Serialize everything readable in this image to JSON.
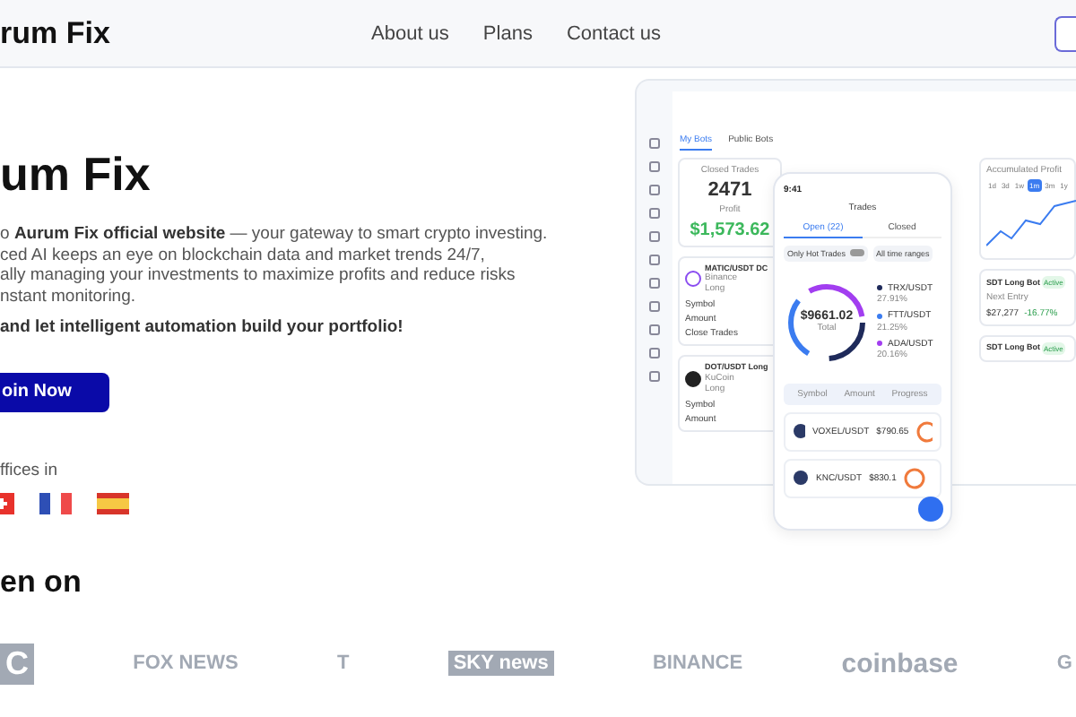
{
  "header": {
    "logo": "rum Fix",
    "nav": [
      "About us",
      "Plans",
      "Contact us"
    ]
  },
  "hero": {
    "title": "um Fix",
    "lines": [
      "o **Aurum Fix official website** — your gateway to smart crypto investing.",
      "ced AI keeps an eye on blockchain data and market trends 24/7,",
      "ally managing your investments to maximize profits and reduce risks",
      "nstant monitoring."
    ],
    "tagline": "and let intelligent automation build your portfolio!",
    "cta": "oin Now",
    "offices_label": "ffices in"
  },
  "dashboard": {
    "tabs": [
      {
        "label": "My Bots",
        "selected": true
      },
      {
        "label": "Public Bots",
        "selected": false
      }
    ],
    "closed_label": "Closed Trades",
    "closed_value": "2471",
    "profit_label": "Profit",
    "profit_value": "$1,573.62",
    "chart_title": "Accumulated Profit",
    "ranges": [
      {
        "label": "1d",
        "selected": false
      },
      {
        "label": "3d",
        "selected": false
      },
      {
        "label": "1w",
        "selected": false
      },
      {
        "label": "1m",
        "selected": true
      },
      {
        "label": "3m",
        "selected": false
      },
      {
        "label": "1y",
        "selected": false
      }
    ],
    "bots": [
      {
        "pair": "MATIC/USDT DC",
        "exchange": "Binance",
        "side": "Long",
        "fields": [
          "Symbol",
          "Amount",
          "Close Trades"
        ]
      },
      {
        "pair": "DOT/USDT Long",
        "exchange": "KuCoin",
        "side": "Long",
        "fields": [
          "Symbol",
          "Amount"
        ]
      }
    ],
    "right_bots": [
      {
        "title": "SDT Long Bot",
        "status": "Active",
        "stat_label": "Next Entry",
        "stat_value": "$27,277",
        "change": "-16.77%"
      },
      {
        "title": "SDT Long Bot",
        "status": "Active"
      }
    ]
  },
  "phone": {
    "time": "9:41",
    "title": "Trades",
    "tabs": [
      {
        "label": "Open (22)",
        "selected": true
      },
      {
        "label": "Closed",
        "selected": false
      }
    ],
    "filters": [
      {
        "label": "Only Hot Trades",
        "kind": "toggle",
        "on": false
      },
      {
        "label": "All time ranges",
        "kind": "chip"
      }
    ],
    "total": "$9661.02",
    "total_label": "Total",
    "legend": [
      {
        "name": "TRX/USDT",
        "pct": "27.91%",
        "color": "#1e2a5a"
      },
      {
        "name": "FTT/USDT",
        "pct": "21.25%",
        "color": "#3b7cf0"
      },
      {
        "name": "ADA/USDT",
        "pct": "20.16%",
        "color": "#a23ef0"
      }
    ],
    "columns": [
      "Symbol",
      "Amount",
      "Progress"
    ],
    "rows": [
      {
        "pair": "VOXEL/USDT",
        "price": "$790.65"
      },
      {
        "pair": "KNC/USDT",
        "price": "$830.1"
      }
    ]
  },
  "seen_on": {
    "heading": "en on",
    "logos": [
      "C",
      "FOX NEWS",
      "T",
      "SKY news",
      "BINANCE",
      "coinbase",
      "G"
    ]
  }
}
